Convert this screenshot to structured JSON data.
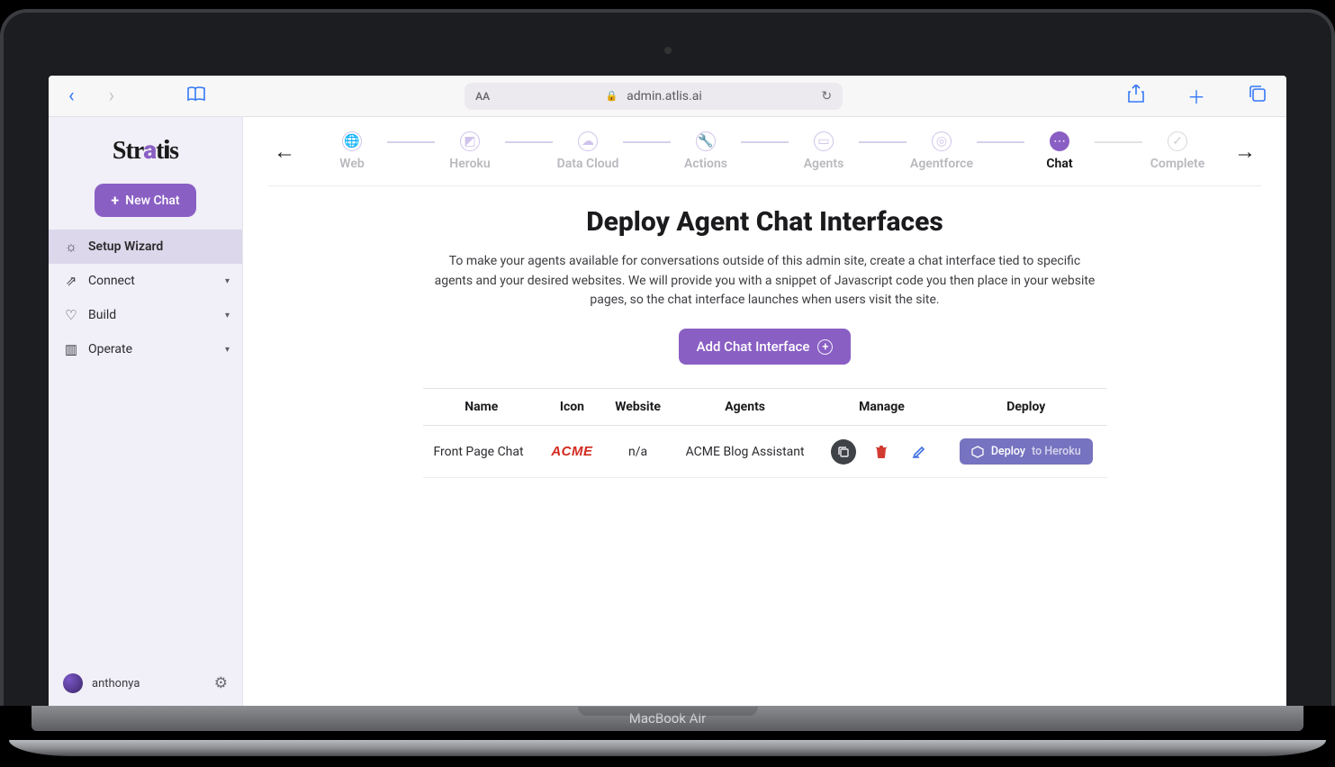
{
  "device_label": "MacBook Air",
  "browser": {
    "url_label": "admin.atlis.ai",
    "aa_label": "AA"
  },
  "brand": {
    "name": "Stratis"
  },
  "sidebar": {
    "new_chat_label": "New Chat",
    "items": [
      {
        "label": "Setup Wizard",
        "icon": "✻"
      },
      {
        "label": "Connect",
        "icon": "↗"
      },
      {
        "label": "Build",
        "icon": "◯"
      },
      {
        "label": "Operate",
        "icon": "▥"
      }
    ],
    "user": "anthonya"
  },
  "wizard": {
    "steps": [
      {
        "key": "web",
        "label": "Web"
      },
      {
        "key": "heroku",
        "label": "Heroku"
      },
      {
        "key": "datacloud",
        "label": "Data Cloud"
      },
      {
        "key": "actions",
        "label": "Actions"
      },
      {
        "key": "agents",
        "label": "Agents"
      },
      {
        "key": "agentforce",
        "label": "Agentforce"
      },
      {
        "key": "chat",
        "label": "Chat"
      },
      {
        "key": "complete",
        "label": "Complete"
      }
    ]
  },
  "page": {
    "title": "Deploy Agent Chat Interfaces",
    "description": "To make your agents available for conversations outside of this admin site, create a chat interface tied to specific agents and your desired websites. We will provide you with a snippet of Javascript code you then place in your website pages, so the chat interface launches when users visit the site.",
    "add_button": "Add Chat Interface"
  },
  "table": {
    "headers": {
      "name": "Name",
      "icon": "Icon",
      "website": "Website",
      "agents": "Agents",
      "manage": "Manage",
      "deploy": "Deploy"
    },
    "rows": [
      {
        "name": "Front Page Chat",
        "icon_text": "ACME",
        "website": "n/a",
        "agents": "ACME Blog Assistant",
        "deploy_label": "Deploy",
        "deploy_suffix": "to Heroku"
      }
    ]
  }
}
